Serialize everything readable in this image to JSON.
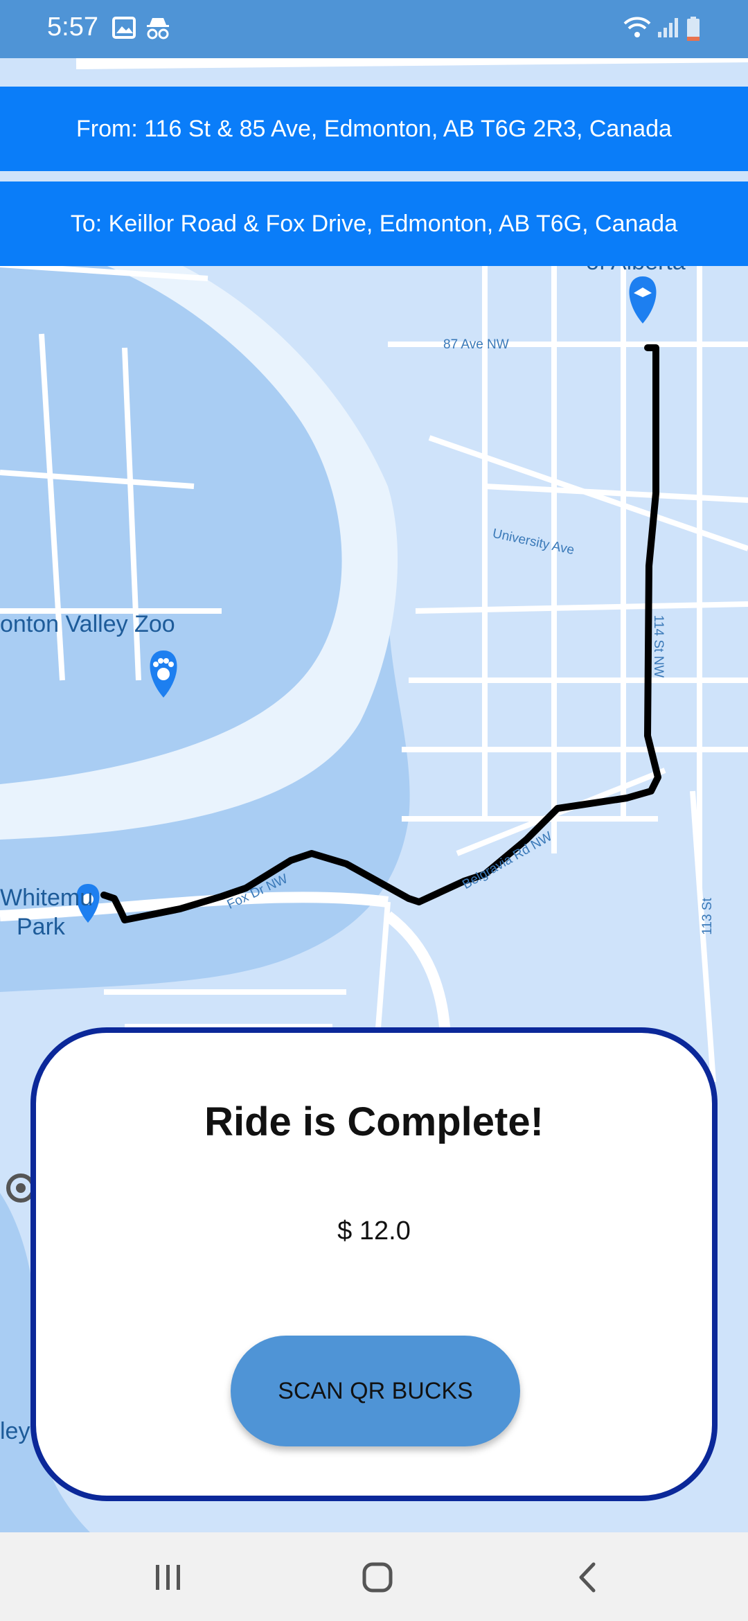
{
  "status_bar": {
    "time": "5:57",
    "icons": [
      "image-icon",
      "incognito-icon",
      "wifi-icon",
      "signal-icon",
      "battery-icon"
    ]
  },
  "route": {
    "from": "From: 116 St & 85 Ave, Edmonton, AB T6G 2R3, Canada",
    "to": "To: Keillor Road & Fox Drive, Edmonton, AB T6G, Canada"
  },
  "map": {
    "streets": [
      "87 Ave NW",
      "University Ave",
      "114 St NW",
      "Fox Dr NW",
      "Belgravia Rd NW",
      "113 St"
    ],
    "places": [
      "onton Valley Zoo",
      "Whitemu",
      "Park",
      "ley",
      "of Alberta"
    ],
    "colors": {
      "water": "#a9cdf3",
      "land": "#cfe3fa",
      "road": "#ffffff",
      "route": "#000000",
      "pin": "#1d7ff0"
    }
  },
  "ride_card": {
    "title": "Ride is Complete!",
    "price": "$ 12.0",
    "button_label": "SCAN QR BUCKS",
    "border_color": "#0b2899",
    "button_color": "#4f94d6"
  },
  "nav_bar": {
    "buttons": [
      "recent-apps-icon",
      "home-icon",
      "back-icon"
    ]
  }
}
